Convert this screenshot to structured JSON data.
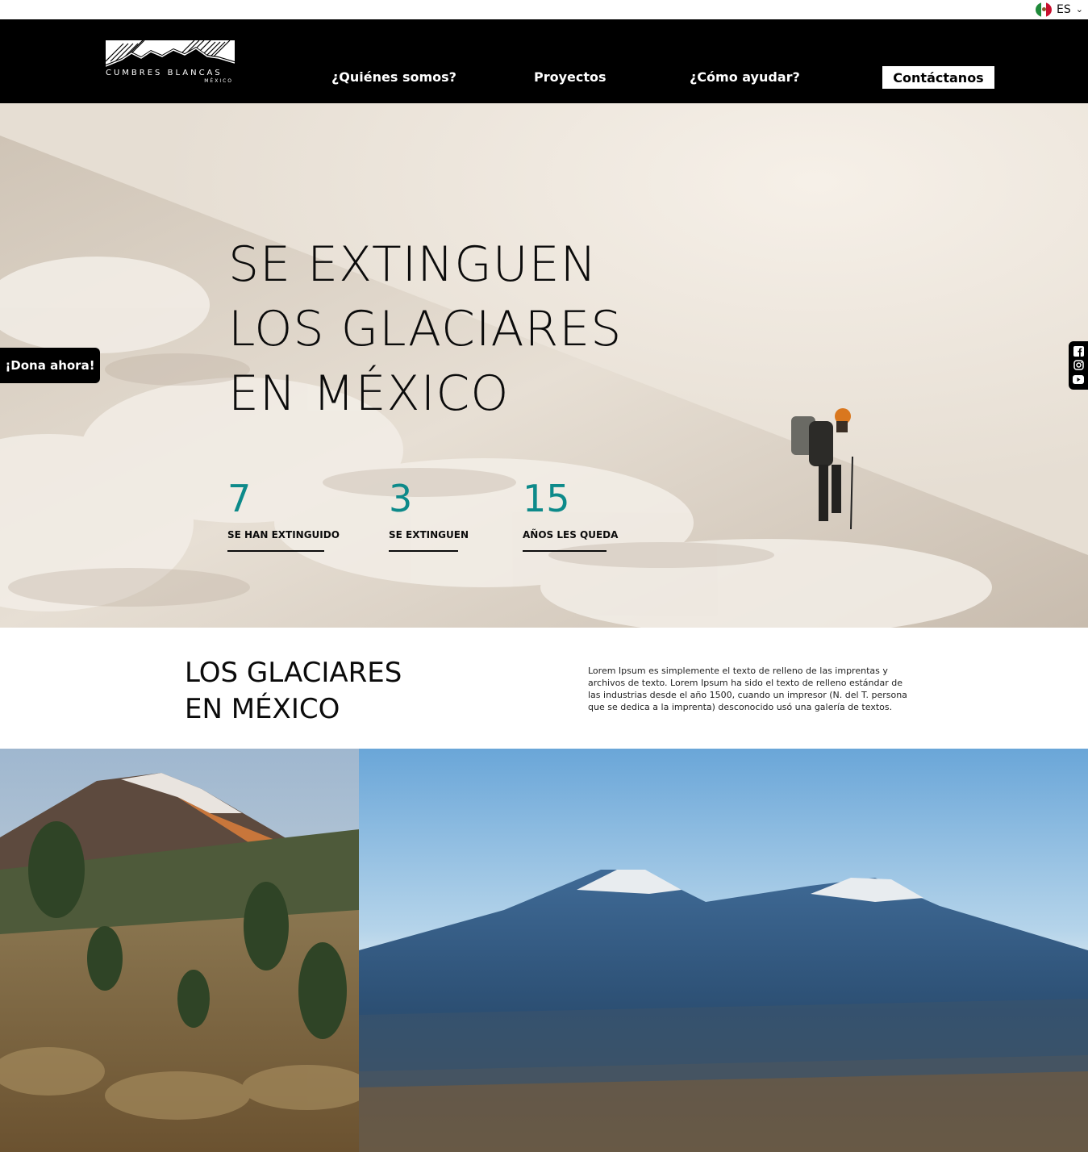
{
  "language": {
    "code": "ES"
  },
  "header": {
    "logo_text": "CUMBRES BLANCAS",
    "logo_sub": "MÉXICO",
    "nav": [
      "¿Quiénes somos?",
      "Proyectos",
      "¿Cómo ayudar?"
    ],
    "cta": "Contáctanos"
  },
  "hero": {
    "title_lines": [
      "SE EXTINGUEN",
      "LOS GLACIARES",
      "EN MÉXICO"
    ],
    "stats": [
      {
        "value": "7",
        "label": "SE HAN EXTINGUIDO"
      },
      {
        "value": "3",
        "label": "SE EXTINGUEN"
      },
      {
        "value": "15",
        "label": "AÑOS LES QUEDA"
      }
    ]
  },
  "donate": {
    "label": "¡Dona ahora!"
  },
  "social": [
    "facebook-icon",
    "instagram-icon",
    "youtube-icon"
  ],
  "intro": {
    "title_lines": [
      "LOS GLACIARES",
      "EN MÉXICO"
    ],
    "text": "Lorem Ipsum es simplemente el texto de relleno de las imprentas y archivos de texto. Lorem Ipsum ha sido el texto de relleno estándar de las industrias desde el año 1500, cuando un impresor (N. del T. persona que se dedica a la imprenta) desconocido usó una galería de textos."
  },
  "colors": {
    "accent": "#0d8a8a",
    "header_bg": "#000000"
  }
}
